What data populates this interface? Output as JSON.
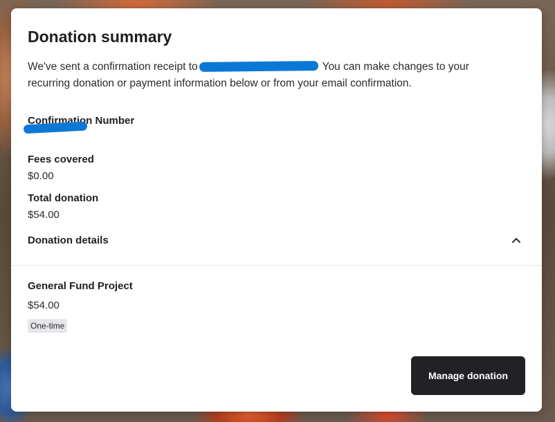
{
  "summary": {
    "title": "Donation summary",
    "intro_before": "We've sent a confirmation receipt to",
    "intro_after": " You can make changes to your recurring donation or payment information below or from your email confirmation.",
    "confirmation_label": "Confirmation Number",
    "fees_label": "Fees covered",
    "fees_value": "$0.00",
    "total_label": "Total donation",
    "total_value": "$54.00"
  },
  "details": {
    "toggle_label": "Donation details",
    "expanded": true,
    "icon": "chevron-up-icon",
    "fund_name": "General Fund Project",
    "fund_amount": "$54.00",
    "frequency_badge": "One-time"
  },
  "actions": {
    "manage_label": "Manage donation"
  },
  "colors": {
    "button_bg": "#222226",
    "redaction": "#0b78d6",
    "badge_bg": "#e6e6ea"
  }
}
